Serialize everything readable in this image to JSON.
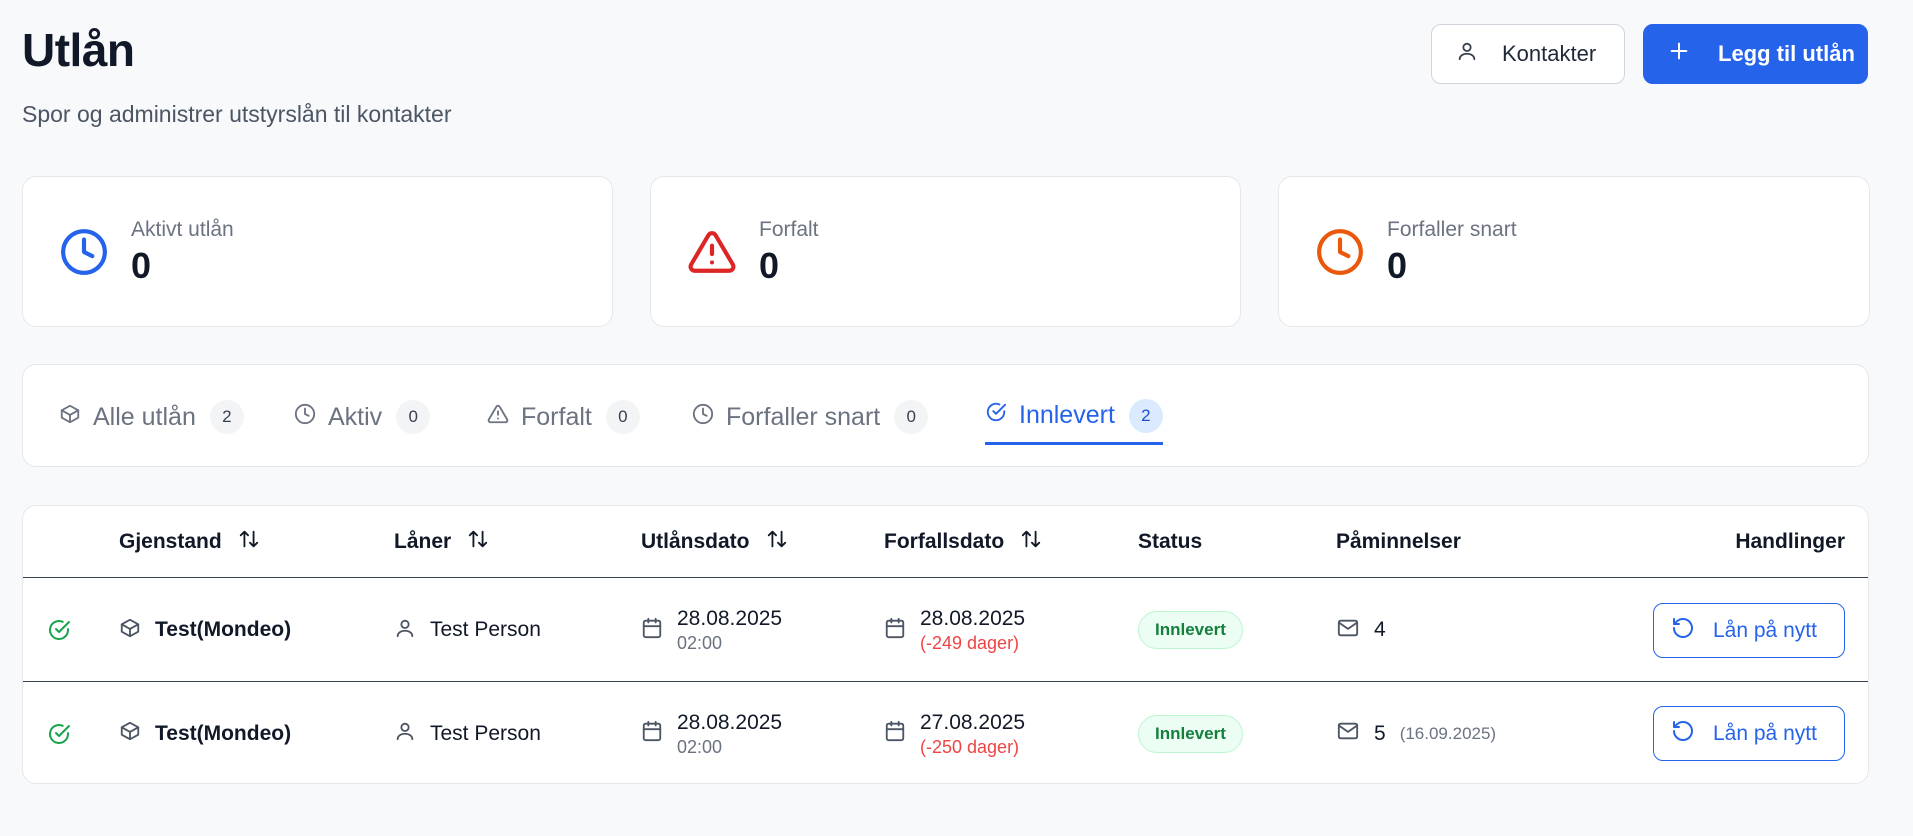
{
  "header": {
    "title": "Utlån",
    "subtitle": "Spor og administrer utstyrslån til kontakter",
    "contacts_button": "Kontakter",
    "add_button": "Legg til utlån"
  },
  "stats": [
    {
      "label": "Aktivt utlån",
      "value": "0",
      "icon": "clock-icon",
      "color": "#2563eb"
    },
    {
      "label": "Forfalt",
      "value": "0",
      "icon": "alert-triangle-icon",
      "color": "#dc2626"
    },
    {
      "label": "Forfaller snart",
      "value": "0",
      "icon": "clock-icon",
      "color": "#ea580c"
    }
  ],
  "tabs": [
    {
      "label": "Alle utlån",
      "count": "2",
      "icon": "package-icon"
    },
    {
      "label": "Aktiv",
      "count": "0",
      "icon": "clock-icon"
    },
    {
      "label": "Forfalt",
      "count": "0",
      "icon": "alert-triangle-icon"
    },
    {
      "label": "Forfaller snart",
      "count": "0",
      "icon": "clock-icon"
    },
    {
      "label": "Innlevert",
      "count": "2",
      "icon": "check-circle-icon",
      "active": true
    }
  ],
  "table": {
    "columns": {
      "item": "Gjenstand",
      "borrower": "Låner",
      "loan_date": "Utlånsdato",
      "due_date": "Forfallsdato",
      "status": "Status",
      "reminders": "Påminnelser",
      "actions": "Handlinger"
    },
    "rows": [
      {
        "item": "Test(Mondeo)",
        "borrower": "Test Person",
        "loan_date": "28.08.2025",
        "loan_time": "02:00",
        "due_date": "28.08.2025",
        "due_overdue": "(-249 dager)",
        "status": "Innlevert",
        "reminders": "4",
        "reminder_date": "",
        "action": "Lån på nytt"
      },
      {
        "item": "Test(Mondeo)",
        "borrower": "Test Person",
        "loan_date": "28.08.2025",
        "loan_time": "02:00",
        "due_date": "27.08.2025",
        "due_overdue": "(-250 dager)",
        "status": "Innlevert",
        "reminders": "5",
        "reminder_date": "(16.09.2025)",
        "action": "Lån på nytt"
      }
    ]
  },
  "colors": {
    "accent": "#2563eb",
    "danger": "#dc2626",
    "warning": "#ea580c",
    "success": "#16a34a"
  }
}
